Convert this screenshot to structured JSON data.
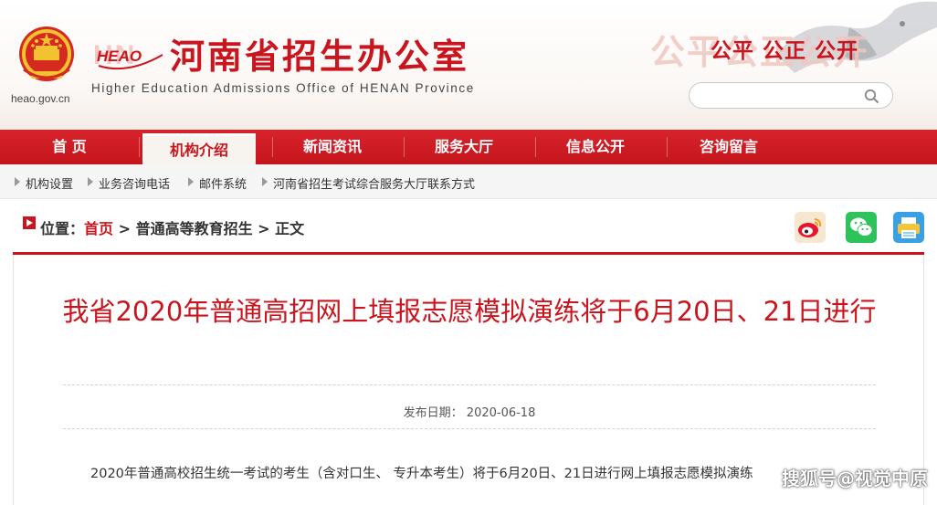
{
  "header": {
    "emblem_url": "heao.gov.cn",
    "logo_text": "HEAO",
    "title": "河南省招生办公室",
    "subtitle": "Higher Education Admissions Office of HENAN Province",
    "motto": "公平 公正 公开",
    "motto_faint": "公平公正公开",
    "search": {
      "placeholder": "",
      "value": ""
    }
  },
  "nav": {
    "items": [
      {
        "label": "首 页"
      },
      {
        "label": "机构介绍",
        "active": true
      },
      {
        "label": "新闻资讯"
      },
      {
        "label": "服务大厅"
      },
      {
        "label": "信息公开"
      },
      {
        "label": "咨询留言"
      }
    ]
  },
  "subnav": {
    "items": [
      {
        "label": "机构设置"
      },
      {
        "label": "业务咨询电话"
      },
      {
        "label": "邮件系统"
      },
      {
        "label": "河南省招生考试综合服务大厅联系方式"
      }
    ]
  },
  "breadcrumb": {
    "prefix": "位置：",
    "home": "首页",
    "sep": " > ",
    "section": "普通高等教育招生",
    "current": "正文"
  },
  "share": {
    "icons": [
      "weibo-icon",
      "wechat-icon",
      "print-icon"
    ]
  },
  "article": {
    "title": "我省2020年普通高招网上填报志愿模拟演练将于6月20日、21日进行",
    "date_label": "发布日期：",
    "date": "2020-06-18",
    "paragraph": "2020年普通高校招生统一考试的考生（含对口生、 专升本考生）将于6月20日、21日进行网上填报志愿模拟演练"
  },
  "watermark": "搜狐号@视觉中原",
  "colors": {
    "brand_red": "#c9151e",
    "nav_red": "#d8232b",
    "subnav_bg": "#f5f5f5"
  }
}
